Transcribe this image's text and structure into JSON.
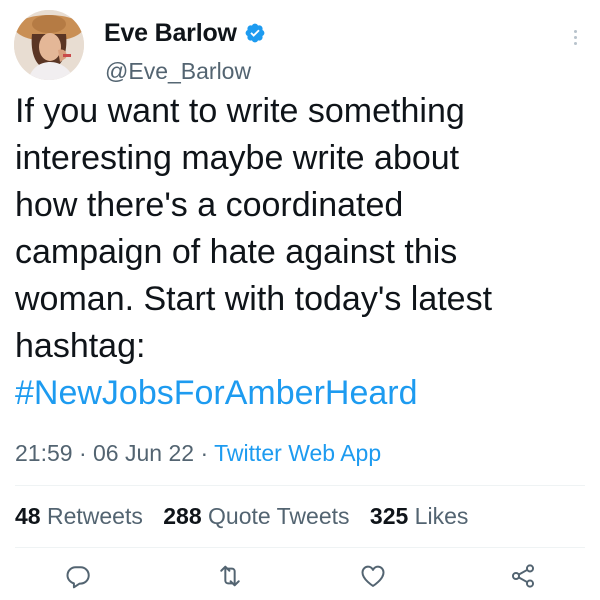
{
  "author": {
    "display_name": "Eve Barlow",
    "handle": "@Eve_Barlow",
    "verified": true
  },
  "tweet": {
    "text_lines": [
      "If you want to write something",
      "interesting maybe write about",
      "how there's a coordinated",
      "campaign of hate against this",
      "woman. Start with today's latest",
      "hashtag:"
    ],
    "hashtag": "#NewJobsForAmberHeard"
  },
  "meta": {
    "time": "21:59",
    "separator": "·",
    "date": "06 Jun 22",
    "source": "Twitter Web App"
  },
  "stats": {
    "retweets_count": "48",
    "retweets_label": "Retweets",
    "quotes_count": "288",
    "quotes_label": "Quote Tweets",
    "likes_count": "325",
    "likes_label": "Likes"
  },
  "icons": {
    "verified": "verified-badge-icon",
    "more": "more-icon",
    "reply": "reply-icon",
    "retweet": "retweet-icon",
    "like": "like-icon",
    "share": "share-icon"
  },
  "colors": {
    "accent": "#1d9bf0",
    "text": "#0f1419",
    "muted": "#536471"
  }
}
